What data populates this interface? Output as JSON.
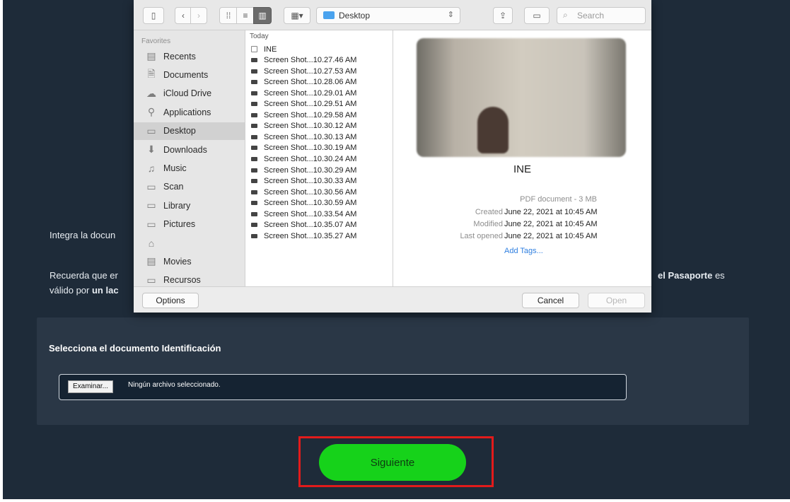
{
  "page": {
    "intro_text": "Integra la docun",
    "reminder_line1_start": "Recuerda que er",
    "reminder_line1_end_bold": "el Pasaporte",
    "reminder_line1_end_suffix": " es",
    "reminder_line2_start": "válido por ",
    "reminder_line2_bold": "un lac"
  },
  "upload": {
    "title": "Selecciona el documento Identificación",
    "browse_label": "Examinar...",
    "no_file_text": "Ningún archivo seleccionado."
  },
  "next_button": {
    "label": "Siguiente"
  },
  "dialog": {
    "location": "Desktop",
    "search_placeholder": "Search",
    "favorites_label": "Favorites",
    "sidebar": [
      {
        "label": "Recents",
        "icon": "recents-icon",
        "glyph": "▤"
      },
      {
        "label": "Documents",
        "icon": "documents-icon",
        "glyph": "🗎"
      },
      {
        "label": "iCloud Drive",
        "icon": "cloud-icon",
        "glyph": "☁"
      },
      {
        "label": "Applications",
        "icon": "applications-icon",
        "glyph": "⚲"
      },
      {
        "label": "Desktop",
        "icon": "desktop-icon",
        "glyph": "▭"
      },
      {
        "label": "Downloads",
        "icon": "downloads-icon",
        "glyph": "⬇"
      },
      {
        "label": "Music",
        "icon": "music-icon",
        "glyph": "♫"
      },
      {
        "label": "Scan",
        "icon": "folder-icon",
        "glyph": "▭"
      },
      {
        "label": "Library",
        "icon": "folder-icon",
        "glyph": "▭"
      },
      {
        "label": "Pictures",
        "icon": "pictures-icon",
        "glyph": "▭"
      },
      {
        "label": "",
        "icon": "home-icon",
        "glyph": "⌂"
      },
      {
        "label": "Movies",
        "icon": "movies-icon",
        "glyph": "▤"
      },
      {
        "label": "Recursos",
        "icon": "folder-icon",
        "glyph": "▭"
      }
    ],
    "active_sidebar": "Desktop",
    "list_header": "Today",
    "files": [
      "INE",
      "Screen Shot...10.27.46 AM",
      "Screen Shot...10.27.53 AM",
      "Screen Shot...10.28.06 AM",
      "Screen Shot...10.29.01 AM",
      "Screen Shot...10.29.51 AM",
      "Screen Shot...10.29.58 AM",
      "Screen Shot...10.30.12 AM",
      "Screen Shot...10.30.13 AM",
      "Screen Shot...10.30.19 AM",
      "Screen Shot...10.30.24 AM",
      "Screen Shot...10.30.29 AM",
      "Screen Shot...10.30.33 AM",
      "Screen Shot...10.30.56 AM",
      "Screen Shot...10.30.59 AM",
      "Screen Shot...10.33.54 AM",
      "Screen Shot...10.35.07 AM",
      "Screen Shot...10.35.27 AM"
    ],
    "preview": {
      "title": "INE",
      "kind": "PDF document - 3 MB",
      "meta": [
        {
          "label": "Created",
          "value": "June 22, 2021 at 10:45 AM"
        },
        {
          "label": "Modified",
          "value": "June 22, 2021 at 10:45 AM"
        },
        {
          "label": "Last opened",
          "value": "June 22, 2021 at 10:45 AM"
        }
      ],
      "add_tags": "Add Tags..."
    },
    "options_label": "Options",
    "cancel_label": "Cancel",
    "open_label": "Open"
  },
  "colors": {
    "page_bg": "#1e2b39",
    "accent_green": "#16d21a",
    "highlight_red": "#e21b1b",
    "mac_blue": "#4aa3ee"
  }
}
